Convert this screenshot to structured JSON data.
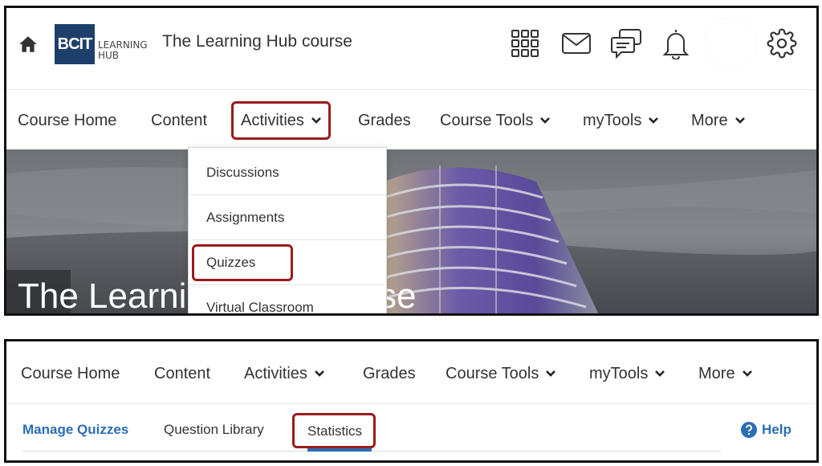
{
  "header": {
    "logo_main": "BCIT",
    "logo_line1": "LEARNING",
    "logo_line2": "HUB",
    "course_title": "The Learning Hub course"
  },
  "nav": {
    "items": [
      {
        "label": "Course Home",
        "has_menu": false
      },
      {
        "label": "Content",
        "has_menu": false
      },
      {
        "label": "Activities",
        "has_menu": true
      },
      {
        "label": "Grades",
        "has_menu": false
      },
      {
        "label": "Course Tools",
        "has_menu": true
      },
      {
        "label": "myTools",
        "has_menu": true
      },
      {
        "label": "More",
        "has_menu": true
      }
    ]
  },
  "activities_menu": {
    "items": [
      "Discussions",
      "Assignments",
      "Quizzes",
      "Virtual Classroom"
    ]
  },
  "hero": {
    "title": "The Learning Hub course"
  },
  "quizzes_subnav": {
    "tabs": [
      "Manage Quizzes",
      "Question Library",
      "Statistics"
    ],
    "help_label": "Help"
  },
  "colors": {
    "highlight": "#9b1b1b",
    "link": "#2a6eb5",
    "logo_bg": "#1d3f6b"
  },
  "icons": [
    "home-icon",
    "app-grid-icon",
    "mail-icon",
    "chat-icon",
    "bell-icon",
    "gear-icon",
    "chevron-down-icon",
    "help-icon"
  ]
}
